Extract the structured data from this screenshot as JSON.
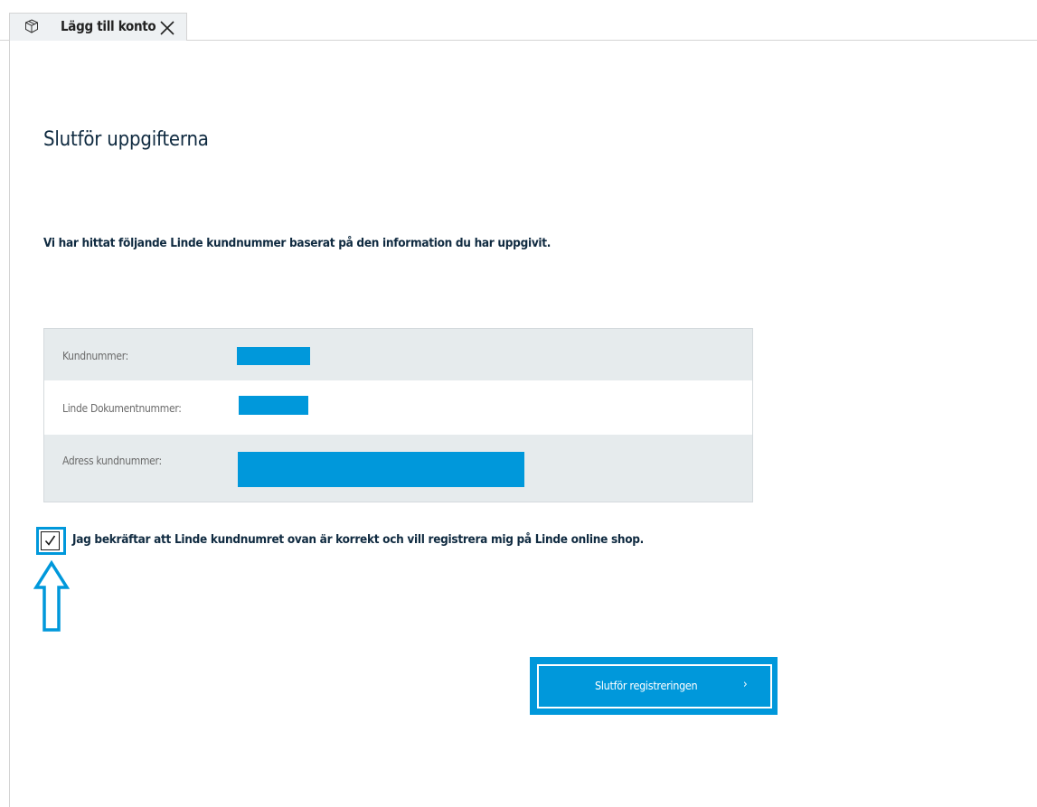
{
  "tab": {
    "label": "Lägg till konto",
    "icon": "package-box-icon",
    "close_icon": "close-icon"
  },
  "page": {
    "title": "Slutför uppgifterna",
    "intro": "Vi har hittat följande Linde kundnummer baserat på den information du har uppgivit."
  },
  "info": {
    "rows": [
      {
        "label": "Kundnummer:"
      },
      {
        "label": "Linde Dokumentnummer:"
      },
      {
        "label": "Adress kundnummer:"
      }
    ]
  },
  "confirm": {
    "label": "Jag bekräftar att Linde kundnumret ovan är korrekt och vill registrera mig på Linde online shop.",
    "checked": true
  },
  "submit": {
    "label": "Slutför registreringen",
    "chevron": "›"
  },
  "colors": {
    "accent": "#0098db",
    "row_gray": "#e6ebed",
    "heading": "#0f2a40"
  }
}
